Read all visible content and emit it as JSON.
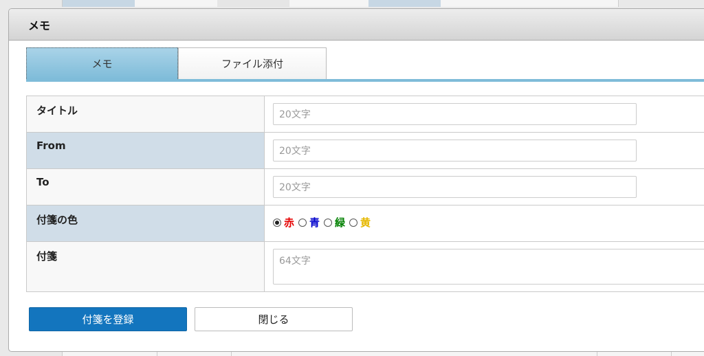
{
  "dialog": {
    "title": "メモ"
  },
  "tabs": [
    {
      "label": "メモ",
      "active": true
    },
    {
      "label": "ファイル添付",
      "active": false
    }
  ],
  "form": {
    "title": {
      "label": "タイトル",
      "placeholder": "20文字"
    },
    "from": {
      "label": "From",
      "placeholder": "20文字"
    },
    "to": {
      "label": "To",
      "placeholder": "20文字"
    },
    "color": {
      "label": "付箋の色",
      "options": [
        {
          "label": "赤",
          "color": "#e60000",
          "checked": true
        },
        {
          "label": "青",
          "color": "#0000cc",
          "checked": false
        },
        {
          "label": "緑",
          "color": "#008000",
          "checked": false
        },
        {
          "label": "黄",
          "color": "#e6b800",
          "checked": false
        }
      ]
    },
    "note": {
      "label": "付箋",
      "placeholder": "64文字"
    }
  },
  "buttons": {
    "register": "付箋を登録",
    "close": "閉じる"
  },
  "colors": {
    "primary_button": "#1375be",
    "tab_active": "#7fbcd9",
    "label_alt_bg": "#d0dde8"
  }
}
